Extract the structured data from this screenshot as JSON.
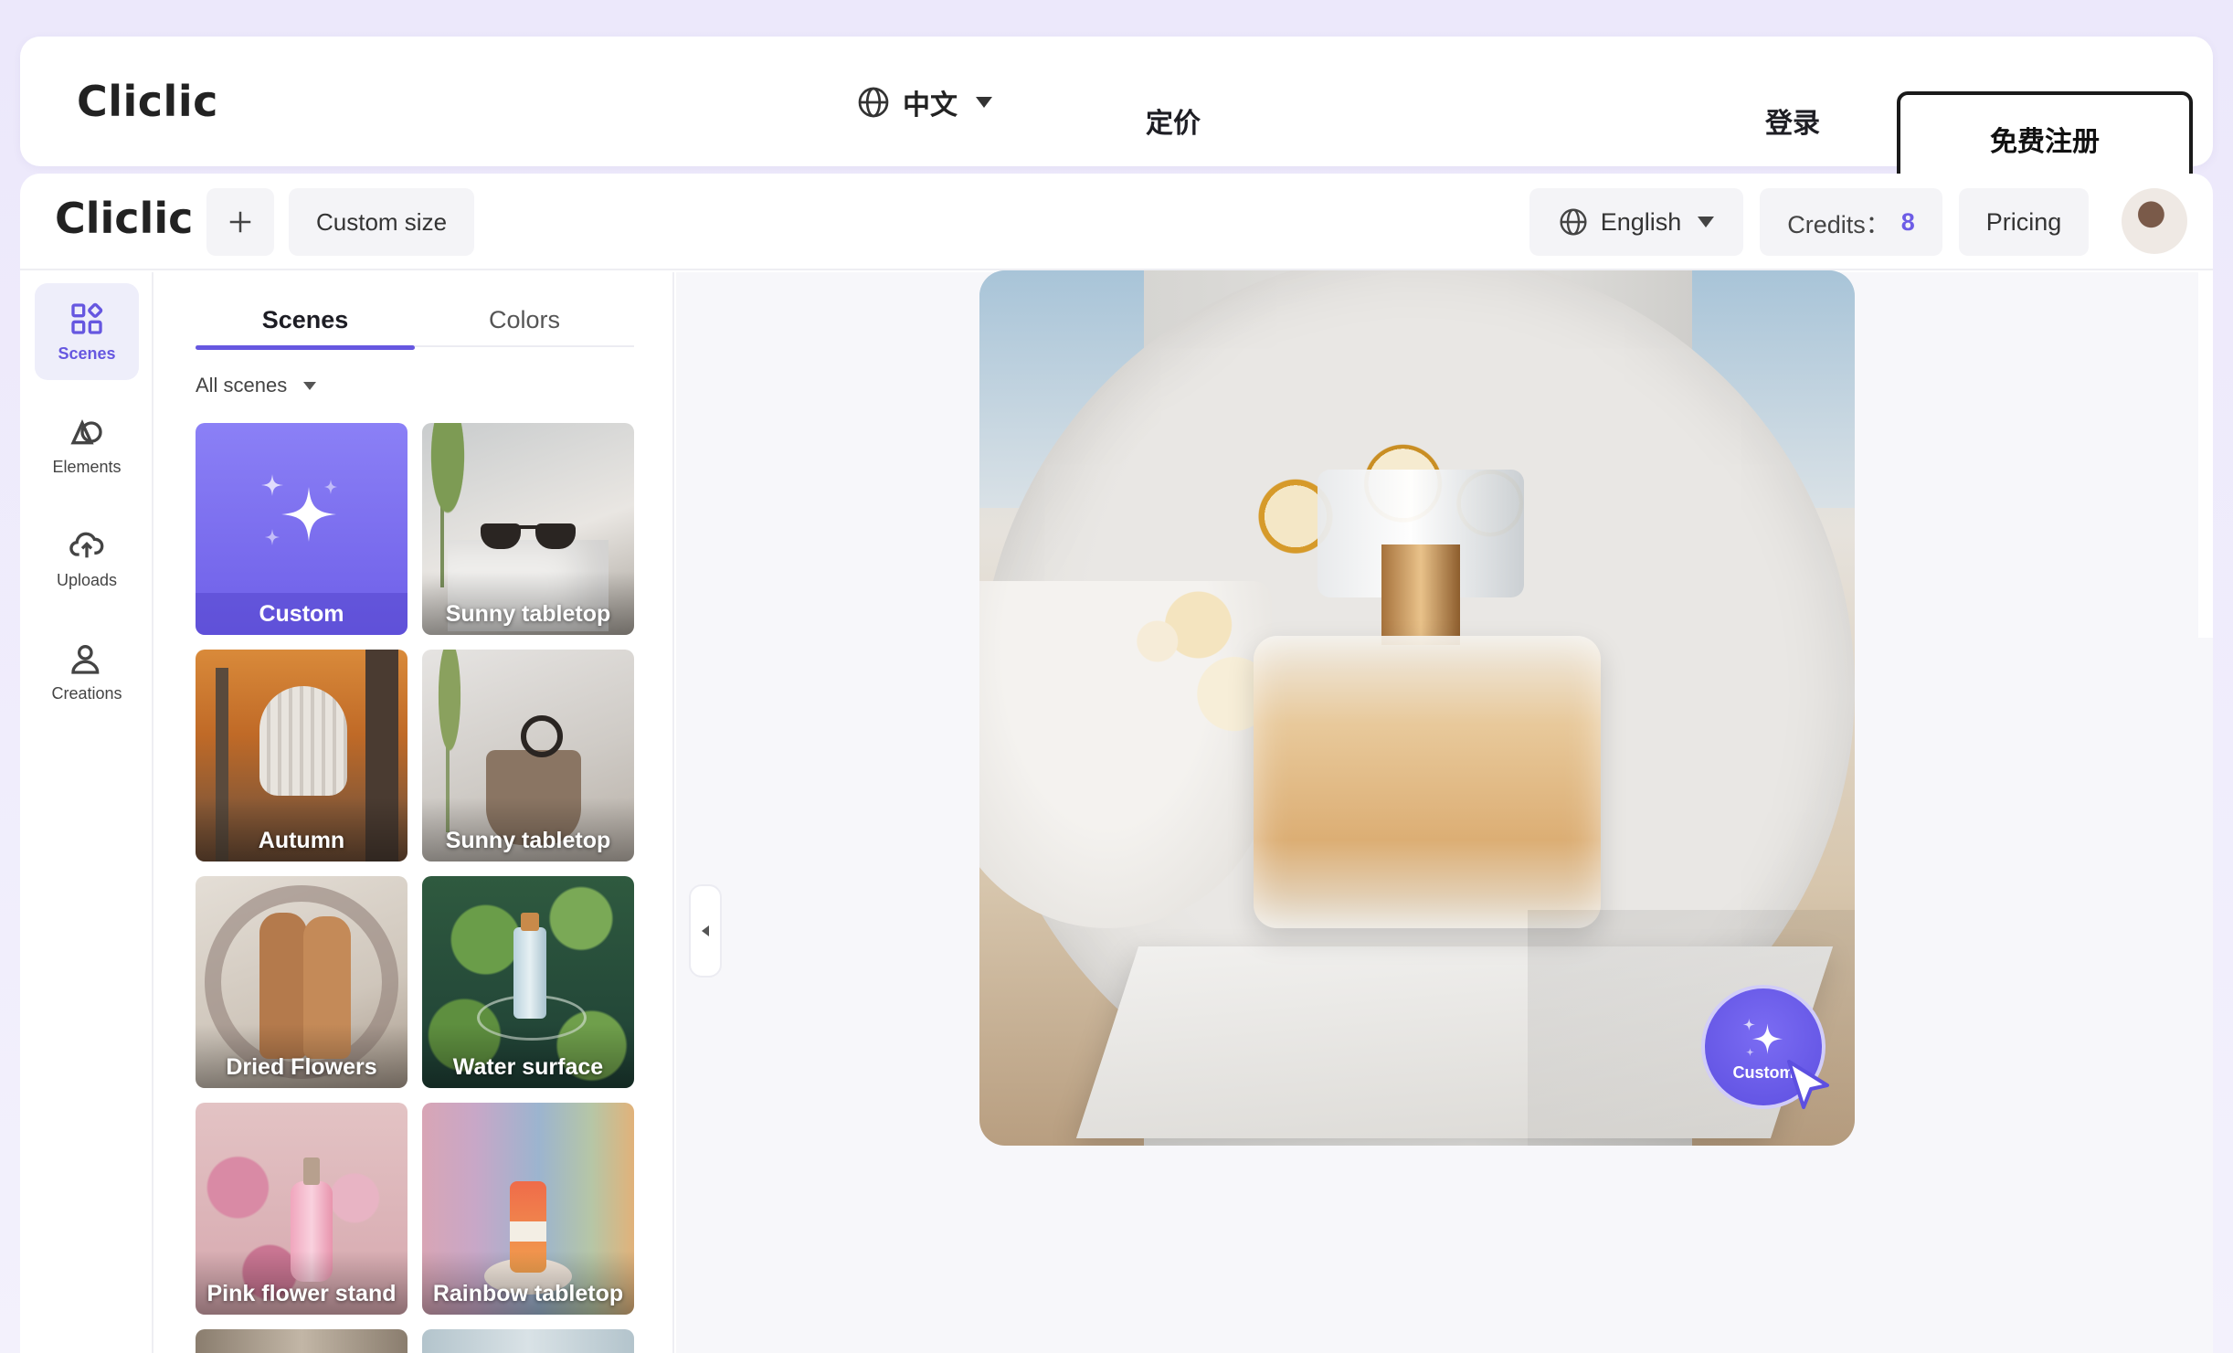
{
  "outer_nav": {
    "logo": "Cliclic",
    "language": "中文",
    "pricing": "定价",
    "login": "登录",
    "signup": "免费注册"
  },
  "header": {
    "logo": "Cliclic",
    "custom_size": "Custom size",
    "language": "English",
    "credits_label": "Credits：",
    "credits_value": "8",
    "pricing": "Pricing"
  },
  "rail": {
    "items": [
      {
        "label": "Scenes",
        "icon": "grid-icon",
        "active": true
      },
      {
        "label": "Elements",
        "icon": "shapes-icon",
        "active": false
      },
      {
        "label": "Uploads",
        "icon": "cloud-upload-icon",
        "active": false
      },
      {
        "label": "Creations",
        "icon": "user-icon",
        "active": false
      }
    ]
  },
  "panel": {
    "tabs": [
      "Scenes",
      "Colors"
    ],
    "active_tab": "Scenes",
    "filter": "All scenes",
    "scenes": [
      "Custom",
      "Sunny tabletop",
      "Autumn",
      "Sunny tabletop",
      "Dried Flowers",
      "Water surface",
      "Pink flower stand",
      "Rainbow tabletop"
    ]
  },
  "canvas": {
    "fab_label": "Custom"
  },
  "colors": {
    "accent": "#6657e0",
    "credits": "#6d5ce6"
  }
}
